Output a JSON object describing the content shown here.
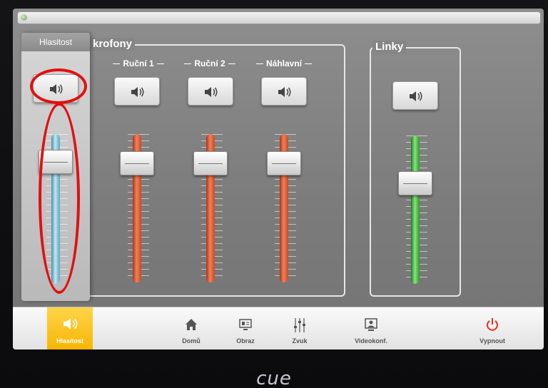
{
  "volume_panel": {
    "title": "Hlasitost",
    "level": 0.78
  },
  "groups": {
    "mics": {
      "title": "krofony",
      "channels": [
        {
          "label": "Ruční 1",
          "level": 0.78
        },
        {
          "label": "Ruční 2",
          "level": 0.78
        },
        {
          "label": "Náhlavní",
          "level": 0.78
        }
      ]
    },
    "lines": {
      "title": "Linky",
      "channels": [
        {
          "label": "",
          "level": 0.64
        }
      ]
    }
  },
  "nav": {
    "items": [
      {
        "label": "Hlasitost",
        "icon": "speaker-icon",
        "active": true
      },
      {
        "label": "Domů",
        "icon": "home-icon",
        "active": false
      },
      {
        "label": "Obraz",
        "icon": "display-icon",
        "active": false
      },
      {
        "label": "Zvuk",
        "icon": "mixer-icon",
        "active": false
      },
      {
        "label": "Videokonf.",
        "icon": "videoconference-icon",
        "active": false
      },
      {
        "label": "Vypnout",
        "icon": "power-icon",
        "active": false
      }
    ]
  },
  "device_brand": "cue",
  "colors": {
    "accent_active": "#f7b400",
    "mic_fader": "#e25a2c",
    "line_fader": "#4cc443",
    "master_fader": "#8fd0e3",
    "highlight_ring": "#e11010",
    "power_icon": "#e1301a"
  }
}
